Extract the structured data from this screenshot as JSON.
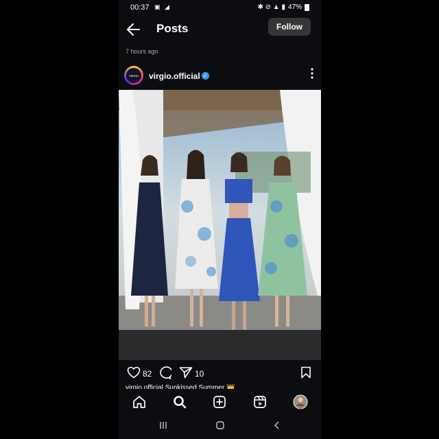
{
  "status": {
    "time": "00:37",
    "battery": "47%"
  },
  "header": {
    "title": "Posts",
    "follow_label": "Follow"
  },
  "post": {
    "time_ago": "7 hours ago",
    "username": "virgio.official",
    "avatar_text": "VIRGIO",
    "likes": "82",
    "shares": "10",
    "caption": "virgio.official Sunkissed Summer 👑"
  },
  "icons": {
    "back": "arrow-left-icon",
    "more": "more-vertical-icon",
    "like": "heart-icon",
    "comment": "comment-icon",
    "share": "send-icon",
    "save": "bookmark-icon",
    "home": "home-icon",
    "search": "search-icon",
    "create": "plus-square-icon",
    "reels": "reels-icon"
  },
  "colors": {
    "background": "#0b0d10",
    "follow_button": "#363636",
    "verified": "#3897f0"
  }
}
